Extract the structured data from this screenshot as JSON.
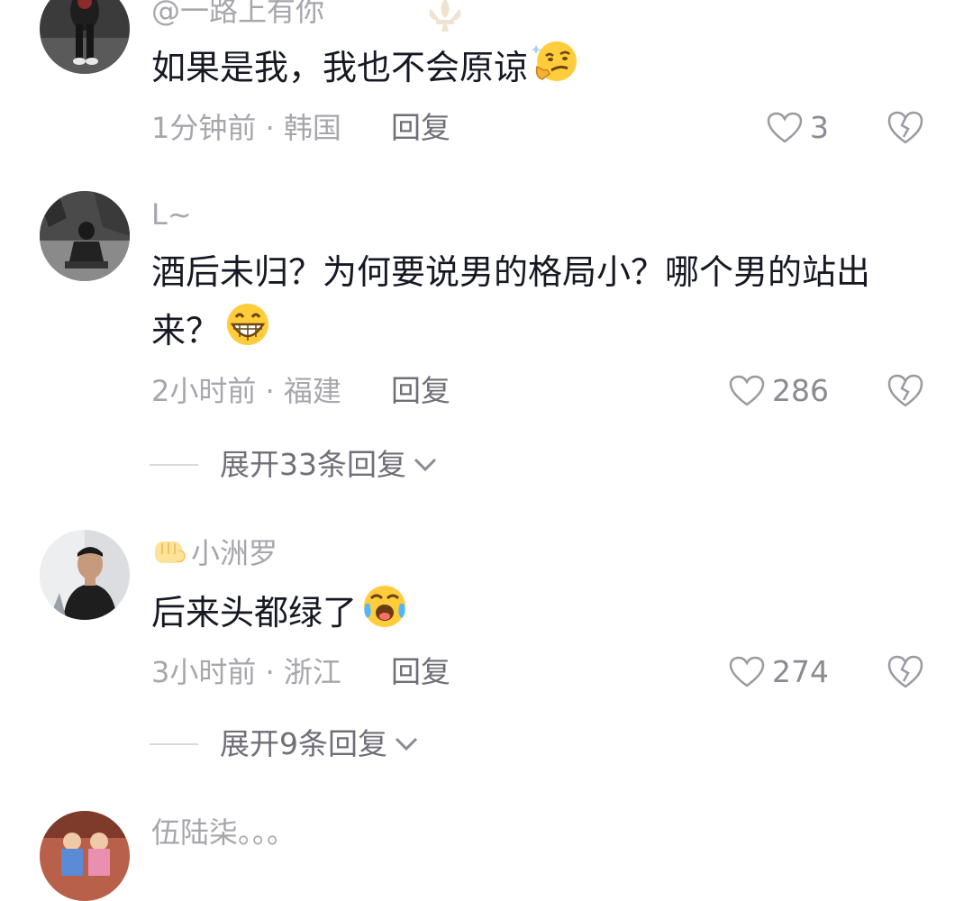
{
  "comments": [
    {
      "username": "@一路上有你",
      "text": "如果是我，我也不会原谅",
      "emoji": "thinking-smirk-emoji",
      "time_location": "1分钟前 · 韩国",
      "reply_label": "回复",
      "likes": "3",
      "avatar": "dark-sneakers-photo"
    },
    {
      "username": "L~",
      "text": "酒后未归？为何要说男的格局小？哪个男的站出来？",
      "emoji": "grinning-emoji",
      "time_location": "2小时前 · 福建",
      "reply_label": "回复",
      "likes": "286",
      "expand_label": "展开33条回复",
      "avatar": "grayscale-person-sitting-photo"
    },
    {
      "username": "小洲罗",
      "text": "后来头都绿了",
      "emoji": "tears-of-joy-emoji",
      "time_location": "3小时前 · 浙江",
      "reply_label": "回复",
      "likes": "274",
      "expand_label": "展开9条回复",
      "avatar": "man-dark-sweater-photo",
      "badge": "fist-emoji"
    },
    {
      "username": "伍陆柒。。。",
      "avatar": "children-photo"
    }
  ],
  "icons": {
    "like": "heart-outline-icon",
    "dislike": "broken-heart-icon",
    "expand": "chevron-down-icon"
  },
  "colors": {
    "username": "#a6a6ad",
    "text": "#161823",
    "meta": "#a6a6ad",
    "reply": "#6f6f78"
  }
}
